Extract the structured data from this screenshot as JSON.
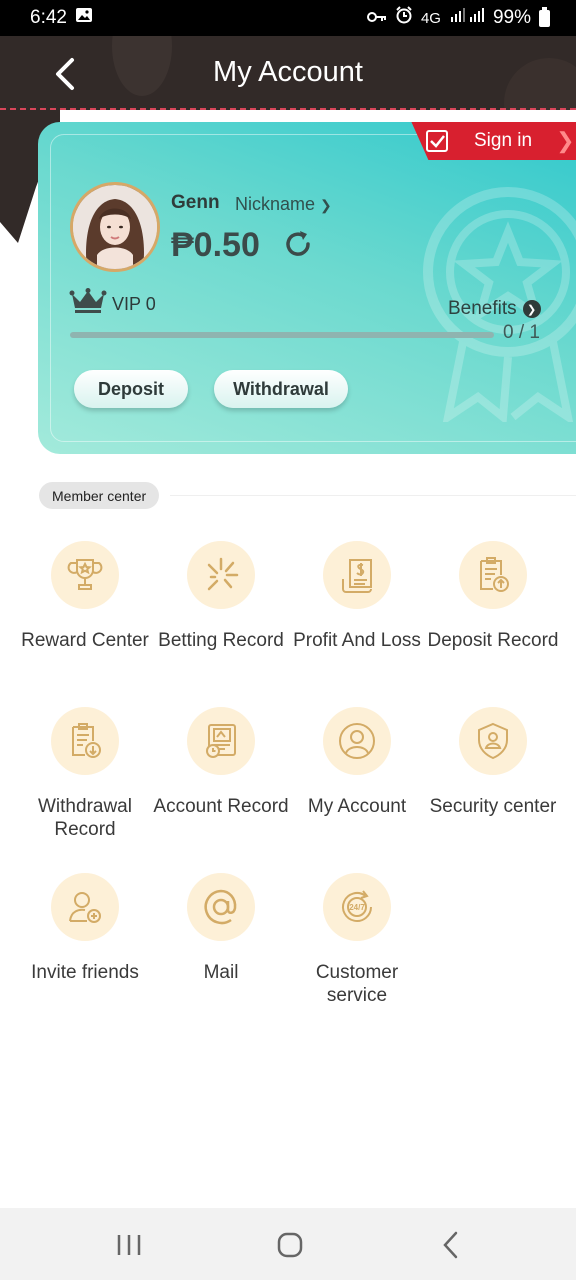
{
  "status_bar": {
    "time": "6:42",
    "network": "4G",
    "battery": "99%",
    "icons": [
      "image-icon",
      "key-icon",
      "alarm-icon",
      "signal-icon",
      "battery-icon"
    ]
  },
  "header": {
    "title": "My Account"
  },
  "card": {
    "sign_in": "Sign in",
    "username": "Genn",
    "nickname_link": "Nickname",
    "balance": "₱0.50",
    "vip": "VIP 0",
    "benefits": "Benefits",
    "progress_text": "0 / 1",
    "progress_value": 0,
    "deposit": "Deposit",
    "withdrawal": "Withdrawal"
  },
  "member_center": {
    "title": "Member center",
    "items": [
      {
        "label": "Reward Center",
        "icon": "trophy-icon"
      },
      {
        "label": "Betting Record",
        "icon": "sparkle-icon"
      },
      {
        "label": "Profit And Loss",
        "icon": "invoice-icon"
      },
      {
        "label": "Deposit Record",
        "icon": "deposit-clipboard-icon"
      },
      {
        "label": "Withdrawal Record",
        "icon": "withdrawal-clipboard-icon"
      },
      {
        "label": "Account Record",
        "icon": "account-record-icon"
      },
      {
        "label": "My Account",
        "icon": "user-icon"
      },
      {
        "label": "Security center",
        "icon": "shield-user-icon"
      },
      {
        "label": "Invite friends",
        "icon": "add-user-icon"
      },
      {
        "label": "Mail",
        "icon": "at-icon"
      },
      {
        "label": "Customer service",
        "icon": "service-24-7-icon"
      }
    ]
  },
  "colors": {
    "accent": "#d8202f",
    "card": "#2fc8cc",
    "icon_bg": "#fdf0d7",
    "icon_stroke": "#d3ab66",
    "header": "#322a28"
  }
}
